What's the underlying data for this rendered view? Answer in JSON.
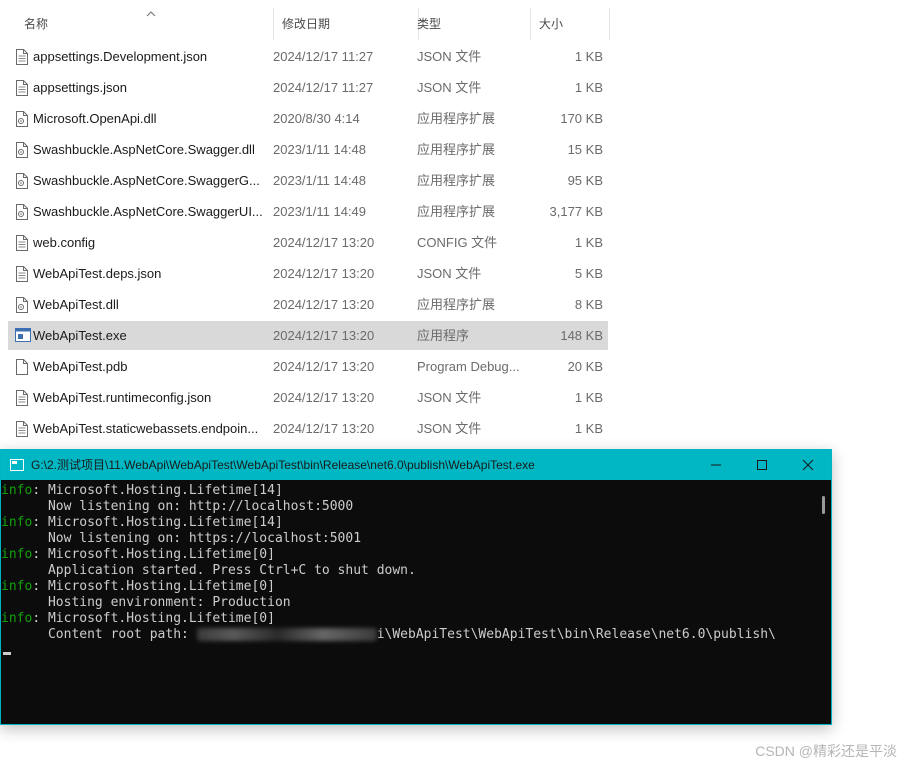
{
  "explorer": {
    "columns": {
      "name": "名称",
      "date": "修改日期",
      "type": "类型",
      "size": "大小"
    },
    "files": [
      {
        "name": "appsettings.Development.json",
        "date": "2024/12/17 11:27",
        "type": "JSON 文件",
        "size": "1 KB",
        "icon": "document-icon"
      },
      {
        "name": "appsettings.json",
        "date": "2024/12/17 11:27",
        "type": "JSON 文件",
        "size": "1 KB",
        "icon": "document-icon"
      },
      {
        "name": "Microsoft.OpenApi.dll",
        "date": "2020/8/30 4:14",
        "type": "应用程序扩展",
        "size": "170 KB",
        "icon": "dll-icon"
      },
      {
        "name": "Swashbuckle.AspNetCore.Swagger.dll",
        "date": "2023/1/11 14:48",
        "type": "应用程序扩展",
        "size": "15 KB",
        "icon": "dll-icon"
      },
      {
        "name": "Swashbuckle.AspNetCore.SwaggerG...",
        "date": "2023/1/11 14:48",
        "type": "应用程序扩展",
        "size": "95 KB",
        "icon": "dll-icon"
      },
      {
        "name": "Swashbuckle.AspNetCore.SwaggerUI...",
        "date": "2023/1/11 14:49",
        "type": "应用程序扩展",
        "size": "3,177 KB",
        "icon": "dll-icon"
      },
      {
        "name": "web.config",
        "date": "2024/12/17 13:20",
        "type": "CONFIG 文件",
        "size": "1 KB",
        "icon": "document-icon"
      },
      {
        "name": "WebApiTest.deps.json",
        "date": "2024/12/17 13:20",
        "type": "JSON 文件",
        "size": "5 KB",
        "icon": "document-icon"
      },
      {
        "name": "WebApiTest.dll",
        "date": "2024/12/17 13:20",
        "type": "应用程序扩展",
        "size": "8 KB",
        "icon": "dll-icon"
      },
      {
        "name": "WebApiTest.exe",
        "date": "2024/12/17 13:20",
        "type": "应用程序",
        "size": "148 KB",
        "icon": "exe-icon",
        "selected": true
      },
      {
        "name": "WebApiTest.pdb",
        "date": "2024/12/17 13:20",
        "type": "Program Debug...",
        "size": "20 KB",
        "icon": "blank-file-icon"
      },
      {
        "name": "WebApiTest.runtimeconfig.json",
        "date": "2024/12/17 13:20",
        "type": "JSON 文件",
        "size": "1 KB",
        "icon": "document-icon"
      },
      {
        "name": "WebApiTest.staticwebassets.endpoin...",
        "date": "2024/12/17 13:20",
        "type": "JSON 文件",
        "size": "1 KB",
        "icon": "document-icon"
      }
    ]
  },
  "console": {
    "title": "G:\\2.测试项目\\11.WebApi\\WebApiTest\\WebApiTest\\bin\\Release\\net6.0\\publish\\WebApiTest.exe",
    "title_color": "#00b7c3",
    "lines": [
      {
        "level": "info",
        "sep": ": ",
        "text": "Microsoft.Hosting.Lifetime[14]"
      },
      {
        "indent": "      ",
        "text": "Now listening on: http://localhost:5000"
      },
      {
        "level": "info",
        "sep": ": ",
        "text": "Microsoft.Hosting.Lifetime[14]"
      },
      {
        "indent": "      ",
        "text": "Now listening on: https://localhost:5001"
      },
      {
        "level": "info",
        "sep": ": ",
        "text": "Microsoft.Hosting.Lifetime[0]"
      },
      {
        "indent": "      ",
        "text": "Application started. Press Ctrl+C to shut down."
      },
      {
        "level": "info",
        "sep": ": ",
        "text": "Microsoft.Hosting.Lifetime[0]"
      },
      {
        "indent": "      ",
        "text": "Hosting environment: Production"
      },
      {
        "level": "info",
        "sep": ": ",
        "text": "Microsoft.Hosting.Lifetime[0]"
      },
      {
        "indent": "      ",
        "text": "Content root path: ",
        "redacted": true,
        "tail": "i\\WebApiTest\\WebApiTest\\bin\\Release\\net6.0\\publish\\"
      }
    ]
  },
  "watermark": "CSDN @精彩还是平淡"
}
